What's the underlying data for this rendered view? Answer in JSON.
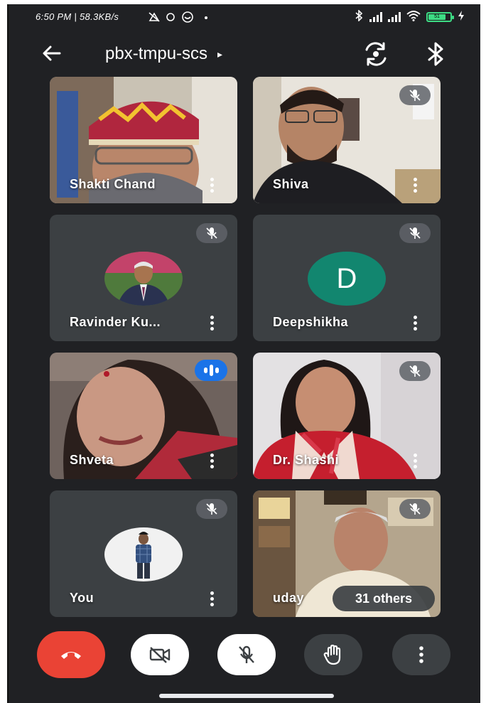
{
  "status_bar": {
    "time_and_speed": "6:50 PM | 58.3KB/s",
    "battery_level": "51"
  },
  "header": {
    "meeting_code": "pbx-tmpu-scs",
    "title_caret": "▸"
  },
  "participants": [
    {
      "name": "Shakti Chand",
      "muted": false,
      "speaking": false
    },
    {
      "name": "Shiva",
      "muted": true,
      "speaking": false
    },
    {
      "name": "Ravinder Ku...",
      "muted": true,
      "speaking": false
    },
    {
      "name": "Deepshikha",
      "muted": true,
      "speaking": false,
      "avatar_letter": "D"
    },
    {
      "name": "Shveta",
      "muted": false,
      "speaking": true
    },
    {
      "name": "Dr. Shashi",
      "muted": true,
      "speaking": false
    },
    {
      "name": "You",
      "muted": true,
      "speaking": false
    },
    {
      "name": "uday",
      "muted": true,
      "speaking": false
    }
  ],
  "others_chip": "31 others",
  "colors": {
    "background": "#202124",
    "tile": "#3c4043",
    "end_call": "#ea4335",
    "speaking": "#1a73e8",
    "avatar_d": "#12866f"
  },
  "icons": {
    "back": "arrow-left-icon",
    "switch_camera": "switch-camera-icon",
    "bluetooth": "bluetooth-icon",
    "muted": "mic-off-icon",
    "end_call": "phone-hangup-icon",
    "camera_off": "video-off-icon",
    "mic_off": "mic-off-icon",
    "raise_hand": "hand-icon",
    "more": "more-vertical-icon"
  }
}
